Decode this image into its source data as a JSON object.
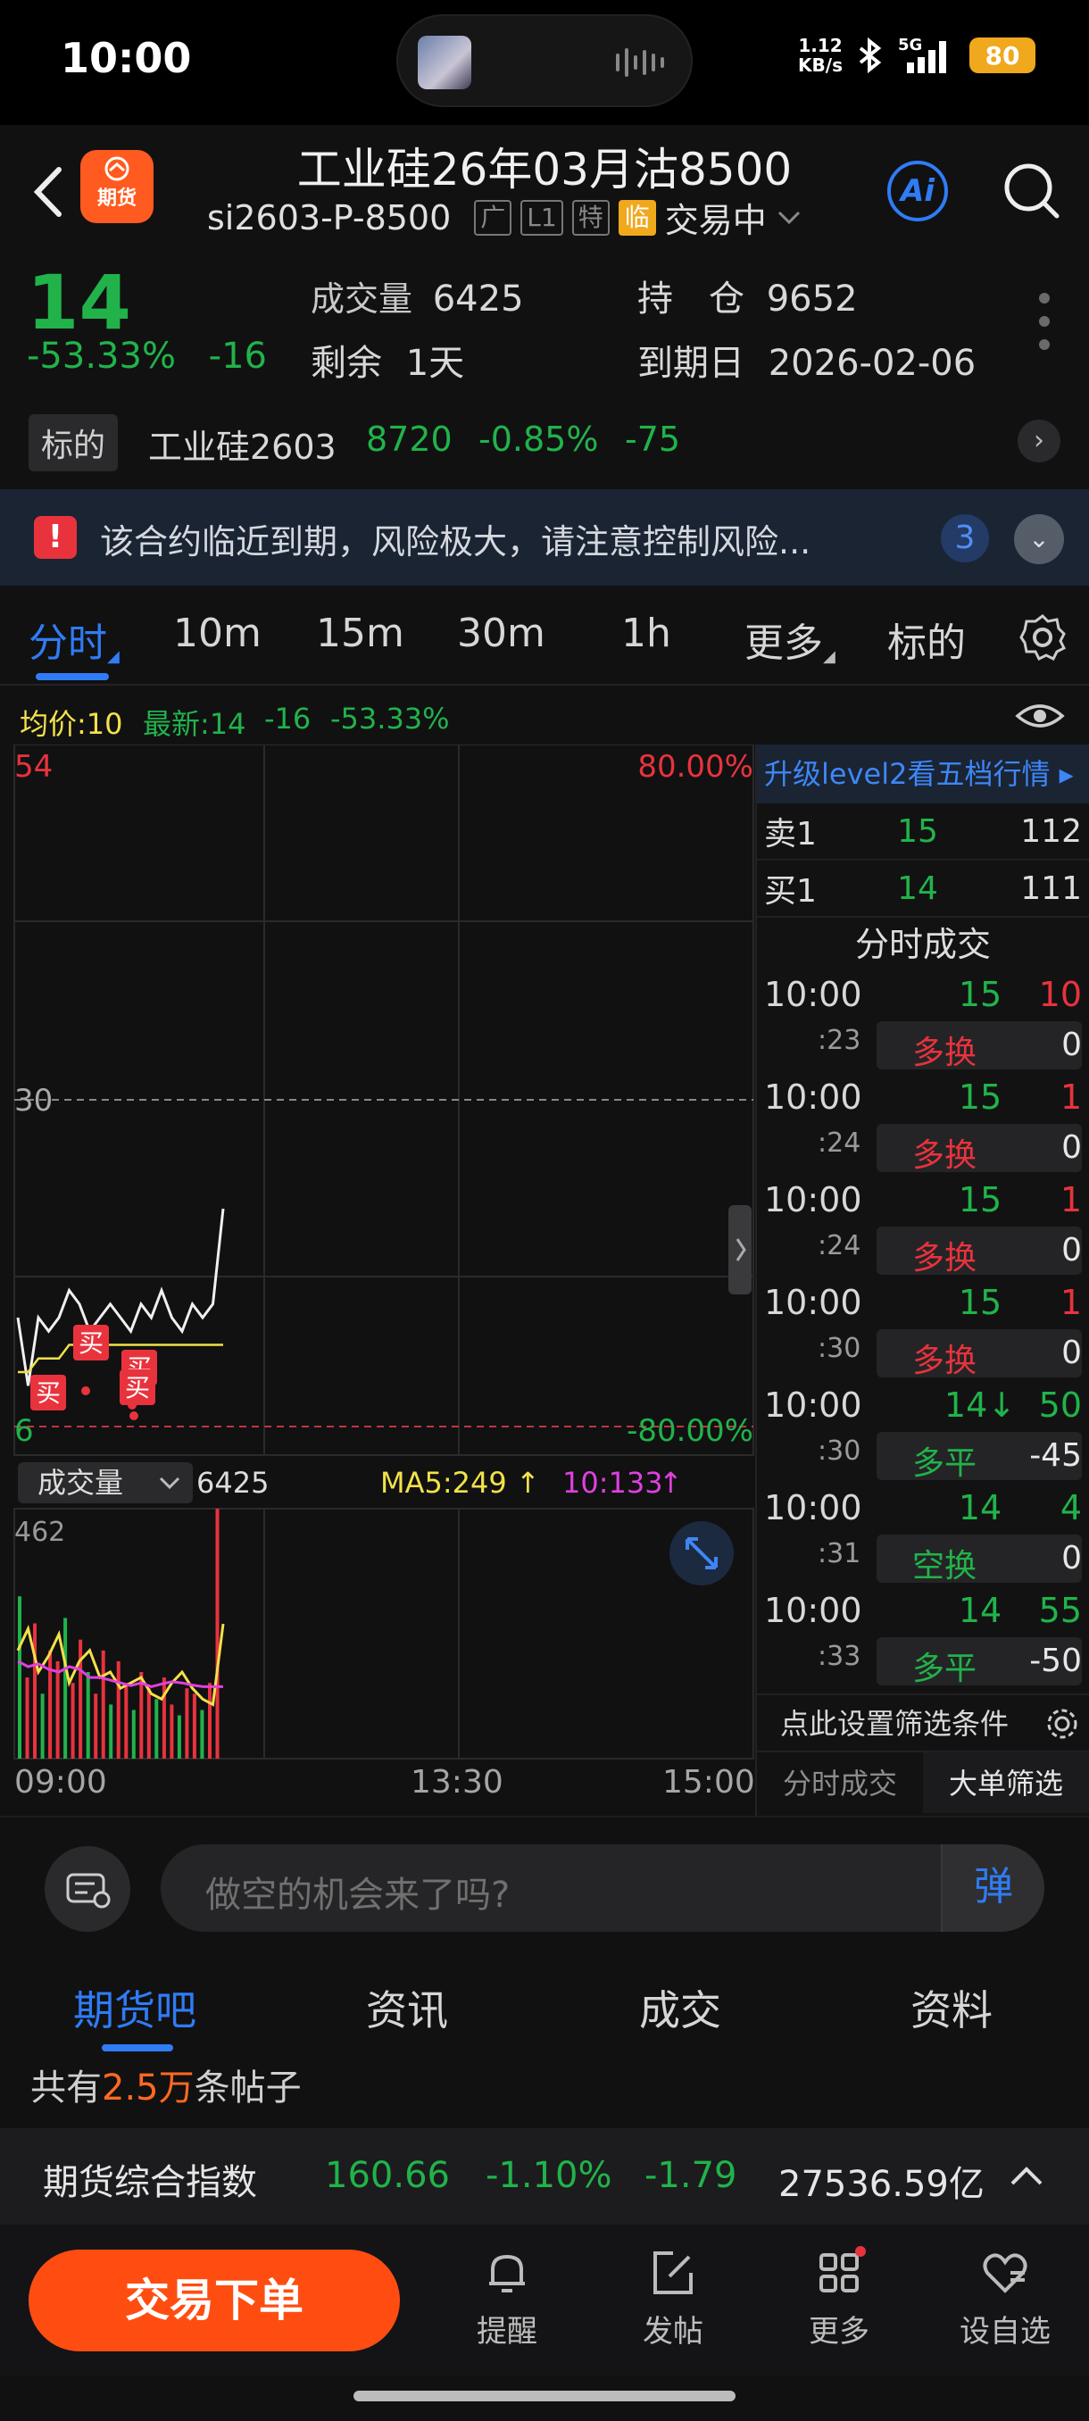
{
  "status_bar": {
    "time": "10:00",
    "net_speed_top": "1.12",
    "net_speed_bottom": "KB/s",
    "battery": "80"
  },
  "header": {
    "title": "工业硅26年03月沽8500",
    "code": "si2603-P-8500",
    "tags": [
      "广",
      "L1",
      "特",
      "临"
    ],
    "state": "交易中",
    "logo_text": "期货",
    "ai_label": "Ai"
  },
  "quote": {
    "price": "14",
    "change_pct": "-53.33%",
    "change": "-16",
    "volume_label": "成交量",
    "volume": "6425",
    "remain_label": "剩余",
    "remain": "1天",
    "oi_label": "持　仓",
    "oi": "9652",
    "expiry_label": "到期日",
    "expiry": "2026-02-06"
  },
  "underlying": {
    "tag": "标的",
    "name": "工业硅2603",
    "price": "8720",
    "pct": "-0.85%",
    "chg": "-75"
  },
  "risk": {
    "text": "该合约临近到期，风险极大，请注意控制风险...",
    "count": "3"
  },
  "chart_tabs": [
    "分时",
    "10m",
    "15m",
    "30m",
    "1h",
    "更多",
    "标的"
  ],
  "avg_line": {
    "avg": "均价:10",
    "latest": "最新:14",
    "chg": "-16",
    "pct": "-53.33%"
  },
  "chart_labels": {
    "ymax": "54",
    "ymid": "30",
    "ymin": "6",
    "pct_top": "80.00%",
    "pct_bottom": "-80.00%",
    "buy_marker": "买",
    "vol_label": "成交量",
    "vol_value": "6425",
    "ma5": "MA5:249",
    "ma10": "10:133",
    "vol_max": "462",
    "time_start": "09:00",
    "time_mid": "13:30",
    "time_end": "15:00"
  },
  "chart_data": {
    "type": "line",
    "title": "",
    "x_range": [
      "09:00",
      "15:00"
    ],
    "ylim": [
      6,
      54
    ],
    "series": [
      {
        "name": "最新",
        "values": [
          14,
          9,
          14,
          13,
          14,
          16,
          15,
          13,
          14,
          15,
          14,
          13,
          15,
          14,
          16,
          14,
          13,
          15,
          14,
          15,
          22
        ]
      },
      {
        "name": "均价",
        "values": [
          10,
          10,
          11,
          11,
          11,
          12,
          12,
          12,
          12,
          12,
          12,
          12,
          12,
          12,
          12,
          12,
          12,
          12,
          12,
          12,
          12
        ]
      }
    ],
    "volume": {
      "ylim": [
        0,
        462
      ],
      "values": [
        300,
        150,
        250,
        120,
        200,
        180,
        260,
        140,
        220,
        160,
        120,
        200,
        100,
        180,
        140,
        90,
        160,
        130,
        110,
        150,
        100,
        80,
        130,
        120,
        90,
        140,
        462
      ],
      "ma5": [
        200,
        240,
        160,
        190,
        230,
        140,
        180,
        200,
        150,
        160,
        130,
        140,
        150,
        120,
        110,
        140,
        160,
        130,
        110,
        100,
        249
      ],
      "ma10": [
        180,
        170,
        175,
        165,
        160,
        170,
        165,
        150,
        150,
        145,
        140,
        135,
        140,
        133,
        138,
        142,
        140,
        136,
        133,
        133,
        133
      ]
    }
  },
  "orderbook": {
    "upgrade": "升级level2看五档行情 ▸",
    "ask": {
      "label": "卖1",
      "price": "15",
      "vol": "112"
    },
    "bid": {
      "label": "买1",
      "price": "14",
      "vol": "111"
    },
    "trades_title": "分时成交",
    "trades": [
      {
        "time": "10:00",
        "sec": ":23",
        "price": "15",
        "vol": "10",
        "vol_color": "#e8333d",
        "kind": "多换",
        "kind_color": "#e8333d",
        "oi": "0"
      },
      {
        "time": "10:00",
        "sec": ":24",
        "price": "15",
        "vol": "1",
        "vol_color": "#e8333d",
        "kind": "多换",
        "kind_color": "#e8333d",
        "oi": "0"
      },
      {
        "time": "10:00",
        "sec": ":24",
        "price": "15",
        "vol": "1",
        "vol_color": "#e8333d",
        "kind": "多换",
        "kind_color": "#e8333d",
        "oi": "0"
      },
      {
        "time": "10:00",
        "sec": ":30",
        "price": "15",
        "vol": "1",
        "vol_color": "#e8333d",
        "kind": "多换",
        "kind_color": "#e8333d",
        "oi": "0"
      },
      {
        "time": "10:00",
        "sec": ":30",
        "price": "14↓",
        "vol": "50",
        "vol_color": "#21b34a",
        "kind": "多平",
        "kind_color": "#21b34a",
        "oi": "-45"
      },
      {
        "time": "10:00",
        "sec": ":31",
        "price": "14",
        "vol": "4",
        "vol_color": "#21b34a",
        "kind": "空换",
        "kind_color": "#21b34a",
        "oi": "0"
      },
      {
        "time": "10:00",
        "sec": ":33",
        "price": "14",
        "vol": "55",
        "vol_color": "#21b34a",
        "kind": "多平",
        "kind_color": "#21b34a",
        "oi": "-50"
      }
    ],
    "filter": "点此设置筛选条件",
    "tabs": [
      "分时成交",
      "大单筛选"
    ]
  },
  "comment": {
    "placeholder": "做空的机会来了吗?",
    "dan": "弹"
  },
  "bottom_tabs": [
    "期货吧",
    "资讯",
    "成交",
    "资料"
  ],
  "posts": {
    "prefix": "共有",
    "count": "2.5万",
    "suffix": "条帖子"
  },
  "index_bar": {
    "name": "期货综合指数",
    "value": "160.66",
    "pct": "-1.10%",
    "chg": "-1.79",
    "amount": "27536.59亿"
  },
  "bottom_nav": {
    "order": "交易下单",
    "items": [
      "提醒",
      "发帖",
      "更多",
      "设自选"
    ]
  },
  "colors": {
    "up": "#e8333d",
    "down": "#21b34a",
    "accent": "#2f7cf6",
    "orange": "#ff4d12"
  }
}
